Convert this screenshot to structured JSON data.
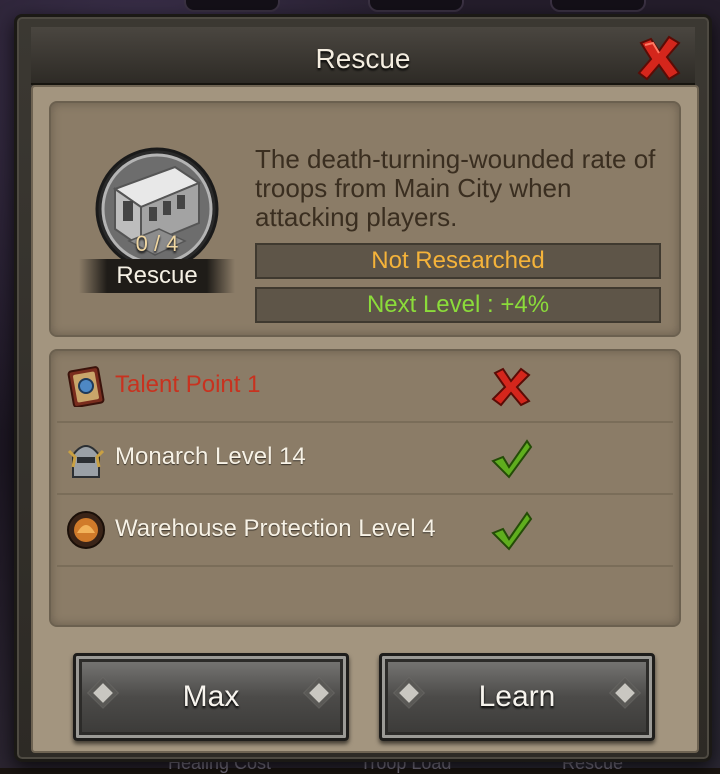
{
  "background": {
    "footer_labels": [
      "Healing Cost",
      "Troop Load",
      "Rescue"
    ]
  },
  "dialog": {
    "title": "Rescue"
  },
  "skill": {
    "name": "Rescue",
    "level": "0 / 4",
    "description": "The death-turning-wounded rate of troops from Main City when attacking players.",
    "status": "Not Researched",
    "next_level": "Next Level : +4%"
  },
  "requirements": [
    {
      "label": "Talent Point 1",
      "icon": "talent-book-icon",
      "met": false
    },
    {
      "label": "Monarch Level 14",
      "icon": "monarch-helmet-icon",
      "met": true
    },
    {
      "label": "Warehouse Protection Level 4",
      "icon": "warehouse-icon",
      "met": true
    }
  ],
  "buttons": {
    "max_label": "Max",
    "learn_label": "Learn"
  },
  "colors": {
    "status_orange": "#f5b33a",
    "next_green": "#8bdc3a",
    "fail_red": "#c8321f",
    "check_green": "#5fae1e"
  }
}
